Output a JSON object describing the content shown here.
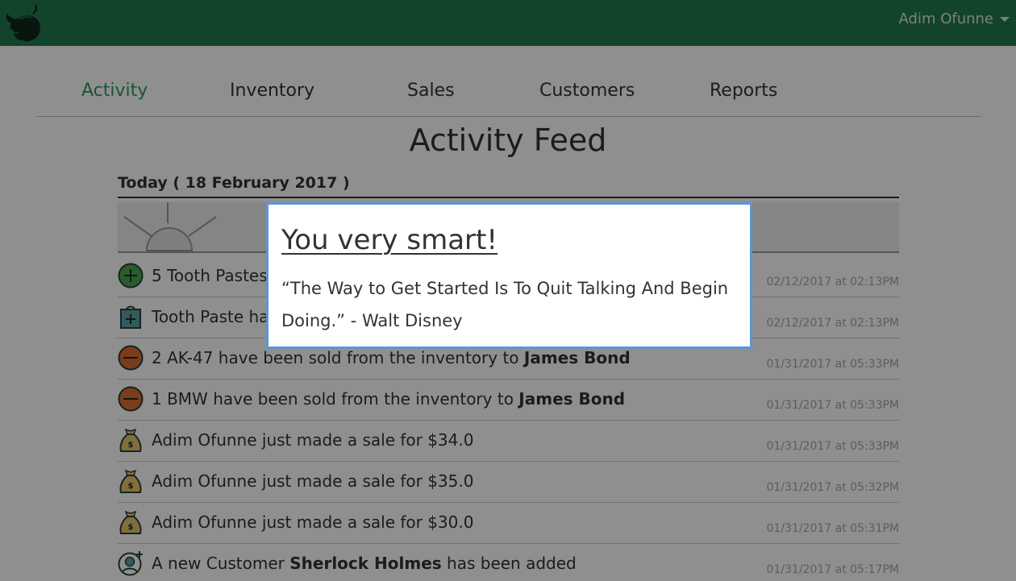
{
  "navbar": {
    "logo_icon": "bull-logo-icon",
    "user_name": "Adim Ofunne",
    "colors": {
      "bar": "#217a4e"
    }
  },
  "tabs": [
    {
      "label": "Activity",
      "active": true
    },
    {
      "label": "Inventory",
      "active": false
    },
    {
      "label": "Sales",
      "active": false
    },
    {
      "label": "Customers",
      "active": false
    },
    {
      "label": "Reports",
      "active": false
    }
  ],
  "page_title": "Activity Feed",
  "day_header": "Today ( 18 February 2017 )",
  "day_banner_icon": "sunrise-icon",
  "feed": [
    {
      "icon": "plus-circle-icon",
      "text_pre": "5 Tooth Pastes",
      "bold": "",
      "text_post": "",
      "time": "02/12/2017 at 02:13PM"
    },
    {
      "icon": "shopping-bag-plus-icon",
      "text_pre": "Tooth Paste ha",
      "bold": "",
      "text_post": "",
      "time": "02/12/2017 at 02:13PM"
    },
    {
      "icon": "minus-circle-icon",
      "text_pre": "2 AK-47 have been sold from the inventory to ",
      "bold": "James Bond",
      "text_post": "",
      "time": "01/31/2017 at 05:33PM"
    },
    {
      "icon": "minus-circle-icon",
      "text_pre": "1 BMW have been sold from the inventory to ",
      "bold": "James Bond",
      "text_post": "",
      "time": "01/31/2017 at 05:33PM"
    },
    {
      "icon": "money-bag-icon",
      "text_pre": "Adim Ofunne just made a sale for $34.0",
      "bold": "",
      "text_post": "",
      "time": "01/31/2017 at 05:33PM"
    },
    {
      "icon": "money-bag-icon",
      "text_pre": "Adim Ofunne just made a sale for $35.0",
      "bold": "",
      "text_post": "",
      "time": "01/31/2017 at 05:32PM"
    },
    {
      "icon": "money-bag-icon",
      "text_pre": "Adim Ofunne just made a sale for $30.0",
      "bold": "",
      "text_post": "",
      "time": "01/31/2017 at 05:31PM"
    },
    {
      "icon": "add-customer-icon",
      "text_pre": "A new Customer ",
      "bold": "Sherlock Holmes",
      "text_post": " has been added",
      "time": "01/31/2017 at 05:17PM"
    }
  ],
  "modal": {
    "title": "You very smart!",
    "quote": "“The Way to Get Started Is To Quit Talking And Begin Doing.” - Walt Disney",
    "border_color": "#5f96cf"
  }
}
